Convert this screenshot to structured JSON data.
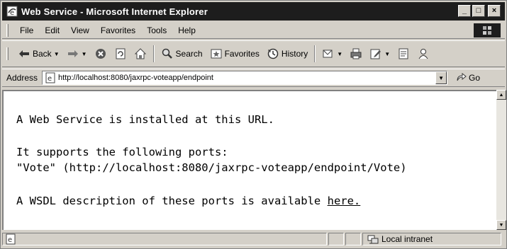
{
  "window": {
    "title": "Web Service - Microsoft Internet Explorer",
    "controls": {
      "minimize": "_",
      "maximize": "□",
      "close": "×"
    }
  },
  "menu": {
    "items": [
      "File",
      "Edit",
      "View",
      "Favorites",
      "Tools",
      "Help"
    ]
  },
  "toolbar": {
    "back_label": "Back",
    "search_label": "Search",
    "favorites_label": "Favorites",
    "history_label": "History"
  },
  "address": {
    "label": "Address",
    "url": "http://localhost:8080/jaxrpc-voteapp/endpoint",
    "go_label": "Go"
  },
  "page": {
    "line1": "A Web Service is installed at this URL.",
    "line2": "It supports the following ports:",
    "line3": "\"Vote\" (http://localhost:8080/jaxrpc-voteapp/endpoint/Vote)",
    "line4_prefix": "A WSDL description of these ports is available ",
    "line4_link": "here."
  },
  "status": {
    "zone": "Local intranet"
  },
  "colors": {
    "titlebar": "#1d1d1d",
    "chrome": "#d4d0c8"
  }
}
